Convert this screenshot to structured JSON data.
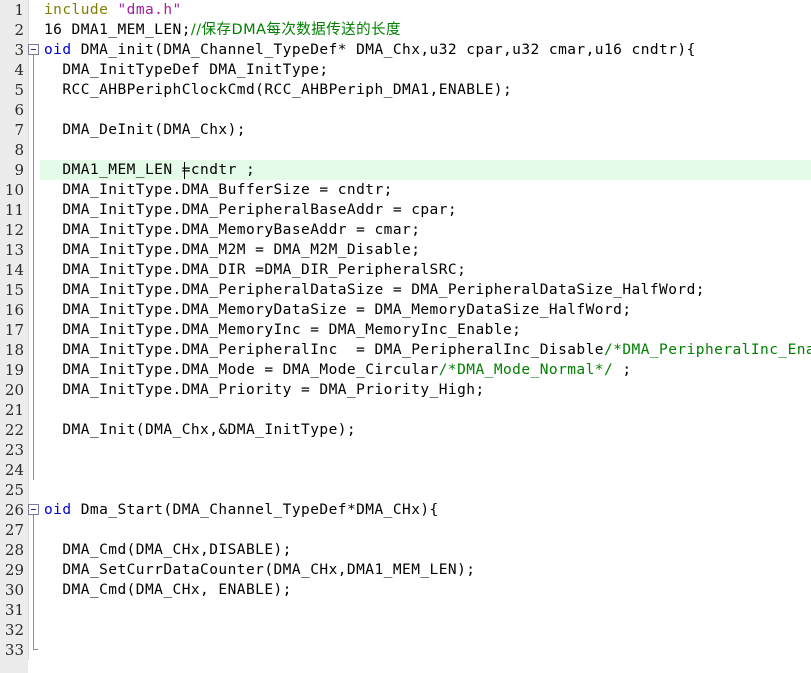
{
  "editor": {
    "name": "code-editor",
    "language": "c",
    "gutter_bg": "#ececec",
    "background": "#ffffff",
    "current_line_highlight": "#e4fbe8",
    "caret_line": 9,
    "caret_column_text": "DMA1_MEM_LEN =cn",
    "horizontally_scrolled": true,
    "colors": {
      "keyword": "#0000d0",
      "preprocessor": "#808000",
      "string": "#a020a0",
      "comment": "#008000",
      "text": "#000000",
      "line_number": "#2b2b2b"
    }
  },
  "lines": [
    {
      "number": "1",
      "fold": "none",
      "highlight": false,
      "tokens": [
        {
          "t": "pre",
          "s": "include"
        },
        {
          "t": "plain",
          "s": " "
        },
        {
          "t": "str",
          "s": "\"dma.h\""
        }
      ]
    },
    {
      "number": "2",
      "fold": "none",
      "highlight": false,
      "tokens": [
        {
          "t": "plain",
          "s": "16 DMA1_MEM_LEN;"
        },
        {
          "t": "cmt",
          "s": "//保存DMA每次数据传送的长度"
        }
      ]
    },
    {
      "number": "3",
      "fold": "box",
      "highlight": false,
      "tokens": [
        {
          "t": "kw",
          "s": "oid"
        },
        {
          "t": "plain",
          "s": " DMA_init(DMA_Channel_TypeDef* DMA_Chx,u32 cpar,u32 cmar,u16 cndtr){"
        }
      ]
    },
    {
      "number": "4",
      "fold": "line",
      "highlight": false,
      "tokens": [
        {
          "t": "plain",
          "s": "  DMA_InitTypeDef DMA_InitType;"
        }
      ]
    },
    {
      "number": "5",
      "fold": "line",
      "highlight": false,
      "tokens": [
        {
          "t": "plain",
          "s": "  RCC_AHBPeriphClockCmd(RCC_AHBPeriph_DMA1,ENABLE);"
        }
      ]
    },
    {
      "number": "6",
      "fold": "line",
      "highlight": false,
      "tokens": [
        {
          "t": "plain",
          "s": ""
        }
      ]
    },
    {
      "number": "7",
      "fold": "line",
      "highlight": false,
      "tokens": [
        {
          "t": "plain",
          "s": "  DMA_DeInit(DMA_Chx);"
        }
      ]
    },
    {
      "number": "8",
      "fold": "line",
      "highlight": false,
      "tokens": [
        {
          "t": "plain",
          "s": ""
        }
      ]
    },
    {
      "number": "9",
      "fold": "line",
      "highlight": true,
      "tokens": [
        {
          "t": "plain",
          "s": "  DMA1_MEM_LEN =cndtr ;"
        }
      ]
    },
    {
      "number": "10",
      "fold": "line",
      "highlight": false,
      "tokens": [
        {
          "t": "plain",
          "s": "  DMA_InitType.DMA_BufferSize = cndtr;"
        }
      ]
    },
    {
      "number": "11",
      "fold": "line",
      "highlight": false,
      "tokens": [
        {
          "t": "plain",
          "s": "  DMA_InitType.DMA_PeripheralBaseAddr = cpar;"
        }
      ]
    },
    {
      "number": "12",
      "fold": "line",
      "highlight": false,
      "tokens": [
        {
          "t": "plain",
          "s": "  DMA_InitType.DMA_MemoryBaseAddr = cmar;"
        }
      ]
    },
    {
      "number": "13",
      "fold": "line",
      "highlight": false,
      "tokens": [
        {
          "t": "plain",
          "s": "  DMA_InitType.DMA_M2M = DMA_M2M_Disable;"
        }
      ]
    },
    {
      "number": "14",
      "fold": "line",
      "highlight": false,
      "tokens": [
        {
          "t": "plain",
          "s": "  DMA_InitType.DMA_DIR =DMA_DIR_PeripheralSRC;"
        }
      ]
    },
    {
      "number": "15",
      "fold": "line",
      "highlight": false,
      "tokens": [
        {
          "t": "plain",
          "s": "  DMA_InitType.DMA_PeripheralDataSize = DMA_PeripheralDataSize_HalfWord;"
        }
      ]
    },
    {
      "number": "16",
      "fold": "line",
      "highlight": false,
      "tokens": [
        {
          "t": "plain",
          "s": "  DMA_InitType.DMA_MemoryDataSize = DMA_MemoryDataSize_HalfWord;"
        }
      ]
    },
    {
      "number": "17",
      "fold": "line",
      "highlight": false,
      "tokens": [
        {
          "t": "plain",
          "s": "  DMA_InitType.DMA_MemoryInc = DMA_MemoryInc_Enable;"
        }
      ]
    },
    {
      "number": "18",
      "fold": "line",
      "highlight": false,
      "tokens": [
        {
          "t": "plain",
          "s": "  DMA_InitType.DMA_PeripheralInc  = DMA_PeripheralInc_Disable"
        },
        {
          "t": "cmt",
          "s": "/*DMA_PeripheralInc_Enable*/"
        }
      ]
    },
    {
      "number": "19",
      "fold": "line",
      "highlight": false,
      "tokens": [
        {
          "t": "plain",
          "s": "  DMA_InitType.DMA_Mode = DMA_Mode_Circular"
        },
        {
          "t": "cmt",
          "s": "/*DMA_Mode_Normal*/"
        },
        {
          "t": "plain",
          "s": " ;"
        }
      ]
    },
    {
      "number": "20",
      "fold": "line",
      "highlight": false,
      "tokens": [
        {
          "t": "plain",
          "s": "  DMA_InitType.DMA_Priority = DMA_Priority_High;"
        }
      ]
    },
    {
      "number": "21",
      "fold": "line",
      "highlight": false,
      "tokens": [
        {
          "t": "plain",
          "s": ""
        }
      ]
    },
    {
      "number": "22",
      "fold": "line",
      "highlight": false,
      "tokens": [
        {
          "t": "plain",
          "s": "  DMA_Init(DMA_Chx,&DMA_InitType);"
        }
      ]
    },
    {
      "number": "23",
      "fold": "line",
      "highlight": false,
      "tokens": [
        {
          "t": "plain",
          "s": ""
        }
      ]
    },
    {
      "number": "24",
      "fold": "line",
      "highlight": false,
      "tokens": [
        {
          "t": "plain",
          "s": ""
        }
      ]
    },
    {
      "number": "25",
      "fold": "none",
      "highlight": false,
      "tokens": [
        {
          "t": "plain",
          "s": ""
        }
      ]
    },
    {
      "number": "26",
      "fold": "box",
      "highlight": false,
      "tokens": [
        {
          "t": "kw",
          "s": "oid"
        },
        {
          "t": "plain",
          "s": " Dma_Start(DMA_Channel_TypeDef*DMA_CHx){"
        }
      ]
    },
    {
      "number": "27",
      "fold": "line",
      "highlight": false,
      "tokens": [
        {
          "t": "plain",
          "s": ""
        }
      ]
    },
    {
      "number": "28",
      "fold": "line",
      "highlight": false,
      "tokens": [
        {
          "t": "plain",
          "s": "  DMA_Cmd(DMA_CHx,DISABLE);"
        }
      ]
    },
    {
      "number": "29",
      "fold": "line",
      "highlight": false,
      "tokens": [
        {
          "t": "plain",
          "s": "  DMA_SetCurrDataCounter(DMA_CHx,DMA1_MEM_LEN);"
        }
      ]
    },
    {
      "number": "30",
      "fold": "line",
      "highlight": false,
      "tokens": [
        {
          "t": "plain",
          "s": "  DMA_Cmd(DMA_CHx, ENABLE);"
        }
      ]
    },
    {
      "number": "31",
      "fold": "line",
      "highlight": false,
      "tokens": [
        {
          "t": "plain",
          "s": ""
        }
      ]
    },
    {
      "number": "32",
      "fold": "line",
      "highlight": false,
      "tokens": [
        {
          "t": "plain",
          "s": ""
        }
      ]
    },
    {
      "number": "33",
      "fold": "end",
      "highlight": false,
      "tokens": [
        {
          "t": "plain",
          "s": ""
        }
      ]
    }
  ]
}
